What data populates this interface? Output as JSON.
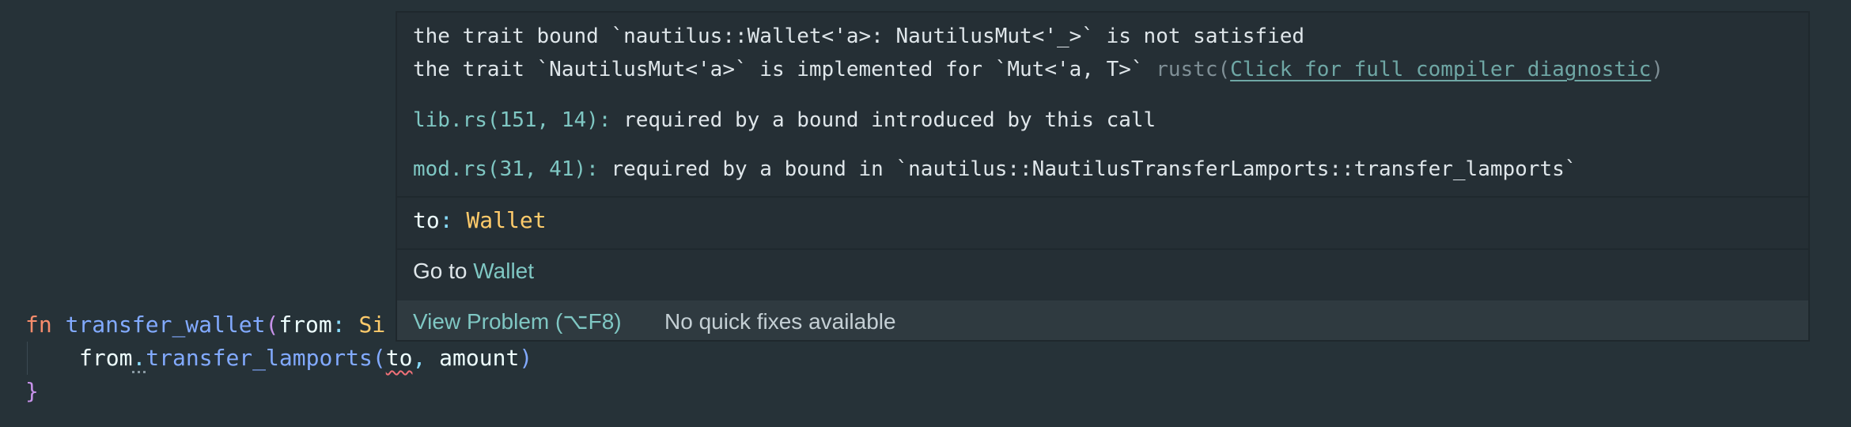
{
  "editor": {
    "line1": {
      "kw": "fn",
      "name": "transfer_wallet",
      "open_paren": "(",
      "param": "from",
      "colon": ": ",
      "type_fragment": "Si"
    },
    "line2": {
      "receiver": "from",
      "dot": ".",
      "method": "transfer_lamports",
      "open_paren": "(",
      "arg1": "to",
      "comma": ", ",
      "arg2": "amount",
      "close_paren": ")"
    },
    "line3": {
      "brace": "}"
    }
  },
  "hover": {
    "error_line1": "the trait bound `nautilus::Wallet<'a>: NautilusMut<'_>` is not satisfied",
    "error_line2": "the trait `NautilusMut<'a>` is implemented for `Mut<'a, T>` ",
    "rustc_prefix": "rustc(",
    "diagnostic_link": "Click for full compiler diagnostic",
    "rustc_suffix": ")",
    "related": [
      {
        "location": "lib.rs(151, 14):",
        "message": " required by a bound introduced by this call"
      },
      {
        "location": "mod.rs(31, 41):",
        "message": " required by a bound in `nautilus::NautilusTransferLamports::transfer_lamports`"
      }
    ],
    "type_info": {
      "name": "to",
      "colon": ": ",
      "type": "Wallet"
    },
    "goto": {
      "prefix": "Go to ",
      "link": "Wallet"
    },
    "actions": {
      "view_problem": "View Problem (⌥F8)",
      "no_quick_fixes": "No quick fixes available"
    }
  },
  "colors": {
    "background": "#263238",
    "hover_background": "#252f35",
    "keyword": "#f78c6c",
    "function": "#82aaff",
    "type": "#ffcb6b",
    "link": "#7fc7c3",
    "error_squiggle": "#f07178"
  }
}
